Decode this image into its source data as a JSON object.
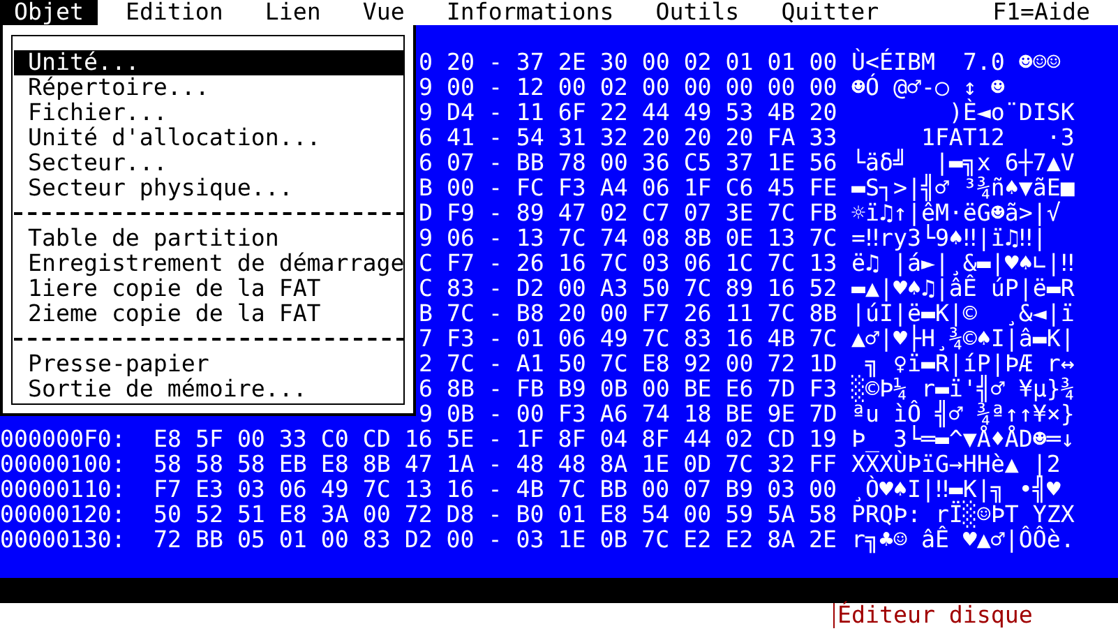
{
  "menubar": {
    "items": [
      {
        "label": "Objet",
        "selected": true
      },
      {
        "label": "Edition",
        "selected": false
      },
      {
        "label": "Lien",
        "selected": false
      },
      {
        "label": "Vue",
        "selected": false
      },
      {
        "label": "Informations",
        "selected": false
      },
      {
        "label": "Outils",
        "selected": false
      },
      {
        "label": "Quitter",
        "selected": false
      }
    ],
    "help": "F1=Aide"
  },
  "dropdown": {
    "items": [
      {
        "kind": "item",
        "label": "Unité...",
        "selected": true
      },
      {
        "kind": "item",
        "label": "Répertoire...",
        "selected": false
      },
      {
        "kind": "item",
        "label": "Fichier...",
        "selected": false
      },
      {
        "kind": "item",
        "label": "Unité d'allocation...",
        "selected": false
      },
      {
        "kind": "item",
        "label": "Secteur...",
        "selected": false
      },
      {
        "kind": "item",
        "label": "Secteur physique...",
        "selected": false
      },
      {
        "kind": "separator"
      },
      {
        "kind": "item",
        "label": "Table de partition",
        "selected": false
      },
      {
        "kind": "item",
        "label": "Enregistrement de démarrage",
        "selected": false
      },
      {
        "kind": "item",
        "label": "1iere copie de la FAT",
        "selected": false
      },
      {
        "kind": "item",
        "label": "2ieme copie de la FAT",
        "selected": false
      },
      {
        "kind": "separator"
      },
      {
        "kind": "item",
        "label": "Presse-papier",
        "selected": false
      },
      {
        "kind": "item",
        "label": "Sortie de mémoire...",
        "selected": false
      }
    ]
  },
  "hex_view": {
    "partial_rows": [
      {
        "hex": "0 20 - 37 2E 30 00 02 01 01 00",
        "ascii": "Ù<ÉIBM  7.0 ☻☺☺"
      },
      {
        "hex": "9 00 - 12 00 02 00 00 00 00 00",
        "ascii": "☻Ó @♂-○ ↕ ☻"
      },
      {
        "hex": "9 D4 - 11 6F 22 44 49 53 4B 20",
        "ascii": "       )È◄o¨DISK"
      },
      {
        "hex": "6 41 - 54 31 32 20 20 20 FA 33",
        "ascii": "     1FAT12   ·3"
      },
      {
        "hex": "6 07 - BB 78 00 36 C5 37 1E 56",
        "ascii": "└äδ╝  |▬╗x 6┼7▲V"
      },
      {
        "hex": "B 00 - FC F3 A4 06 1F C6 45 FE",
        "ascii": "▬S┐>|╣♂ ³¾ñ♠▼ãE■"
      },
      {
        "hex": "D F9 - 89 47 02 C7 07 3E 7C FB",
        "ascii": "☼ï♫↑|êM·ëG☻ã>|√"
      },
      {
        "hex": "9 06 - 13 7C 74 08 8B 0E 13 7C",
        "ascii": "=‼ry3└9♠‼|ï♫‼|"
      },
      {
        "hex": "C F7 - 26 16 7C 03 06 1C 7C 13",
        "ascii": "ë♫ |á►|¸&▬|♥♠∟|‼"
      },
      {
        "hex": "C 83 - D2 00 A3 50 7C 89 16 52",
        "ascii": "▬▲|♥♠♫|âÊ úP|ë▬R"
      },
      {
        "hex": "B 7C - B8 20 00 F7 26 11 7C 8B",
        "ascii": "|úI|ë▬K|©  ¸&◄|ï"
      },
      {
        "hex": "7 F3 - 01 06 49 7C 83 16 4B 7C",
        "ascii": "▲♂|♥├H¸¾©♠I|â▬K|"
      },
      {
        "hex": "2 7C - A1 50 7C E8 92 00 72 1D",
        "ascii": " ╗ ♀ï▬R|íP|ÞÆ r↔"
      },
      {
        "hex": "6 8B - FB B9 0B 00 BE E6 7D F3",
        "ascii": "░©Þ¼ r▬ï'╣♂ ¥µ}¾"
      },
      {
        "hex": "9 0B - 00 F3 A6 74 18 BE 9E 7D",
        "ascii": "ªu ìÔ ╣♂ ¾ª↑↑¥×}"
      }
    ],
    "rows": [
      {
        "offset": "000000F0:",
        "hex": "E8 5F 00 33 C0 CD 16 5E - 1F 8F 04 8F 44 02 CD 19",
        "ascii": "Þ_ 3└═▬^▼Å♦ÅD☻═↓"
      },
      {
        "offset": "00000100:",
        "hex": "58 58 58 EB E8 8B 47 1A - 48 48 8A 1E 0D 7C 32 FF",
        "ascii": "XXXÙÞïG→HHè▲ |2"
      },
      {
        "offset": "00000110:",
        "hex": "F7 E3 03 06 49 7C 13 16 - 4B 7C BB 00 07 B9 03 00",
        "ascii": "¸Ò♥♠I|‼▬K|╗ •╣♥"
      },
      {
        "offset": "00000120:",
        "hex": "50 52 51 E8 3A 00 72 D8 - B0 01 E8 54 00 59 5A 58",
        "ascii": "PRQÞ: rÏ░☺ÞT YZX"
      },
      {
        "offset": "00000130:",
        "hex": "72 BB 05 01 00 83 D2 00 - 03 1E 0B 7C E2 E2 8A 2E",
        "ascii": "r╗♣☺ âÊ ♥▲♂|ÔÔè."
      }
    ]
  },
  "status_bar": {
    "title": "Éditeur disque"
  }
}
